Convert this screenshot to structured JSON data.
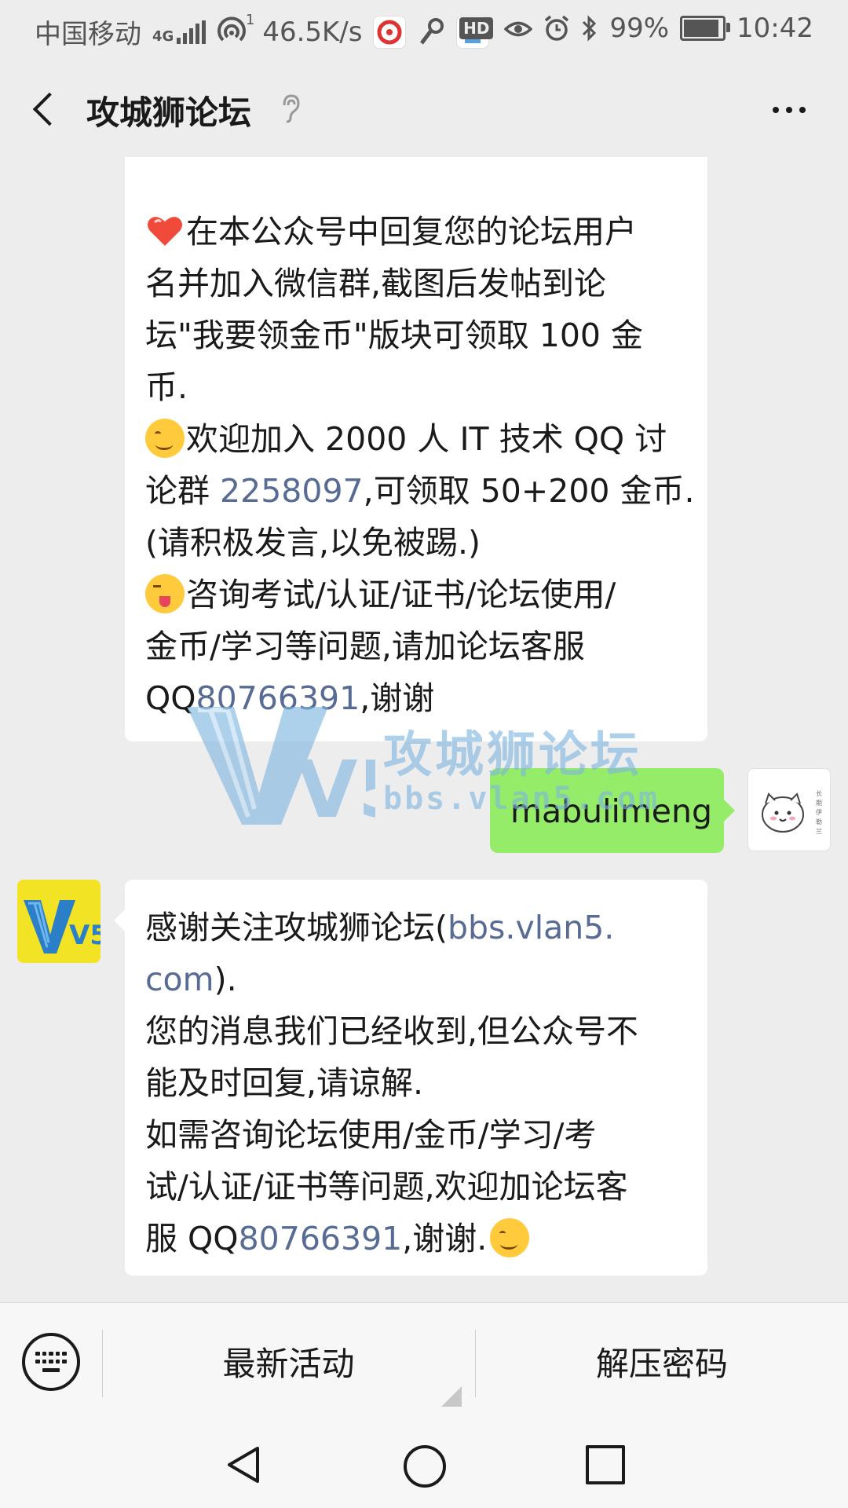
{
  "status_bar": {
    "carrier": "中国移动",
    "network": "4G",
    "hotspot_count": "1",
    "speed": "46.5K/s",
    "hd": "HD",
    "battery": "99%",
    "battery_level": 0.99,
    "time": "10:42"
  },
  "header": {
    "title": "攻城狮论坛"
  },
  "messages": {
    "msg1": {
      "lines": [
        "在本公众号中回复您的论坛用户",
        "名并加入微信群,截图后发帖到论",
        "坛\"我要领金币\"版块可领取 100 金",
        "币.",
        "欢迎加入 2000 人 IT 技术 QQ 讨",
        "论群 ",
        "2258097",
        ",可领取 50+200 金币.",
        "(请积极发言,以免被踢.)",
        "咨询考试/认证/证书/论坛使用/",
        "金币/学习等问题,请加论坛客服",
        "QQ",
        "80766391",
        ",谢谢"
      ]
    },
    "msg2": {
      "text": "mabulimeng"
    },
    "msg3": {
      "lines": [
        "感谢关注攻城狮论坛(",
        "bbs.vlan5.",
        "com",
        ").",
        "您的消息我们已经收到,但公众号不",
        "能及时回复,请谅解.",
        "如需咨询论坛使用/金币/学习/考",
        "试/认证/证书等问题,欢迎加论坛客",
        "服 QQ",
        "80766391",
        ",谢谢."
      ]
    }
  },
  "watermark": {
    "logo": "V5",
    "title": "攻城狮论坛",
    "url": "bbs.vlan5.com"
  },
  "avatars": {
    "official_logo": "V5",
    "user_sticker_text": "长 期 伊 勒 兰"
  },
  "menu": {
    "item1": "最新活动",
    "item2": "解压密码"
  },
  "colors": {
    "link": "#576b95",
    "sent_bubble": "#95ec69",
    "background": "#ededed"
  },
  "icons": [
    "signal-icon",
    "hotspot-icon",
    "netease-app-icon",
    "key-icon",
    "maps-app-icon",
    "eye-icon",
    "alarm-icon",
    "bluetooth-icon",
    "battery-icon",
    "back-icon",
    "listen-ear-icon",
    "more-icon",
    "keyboard-icon",
    "nav-back-icon",
    "nav-home-icon",
    "nav-recent-icon"
  ]
}
